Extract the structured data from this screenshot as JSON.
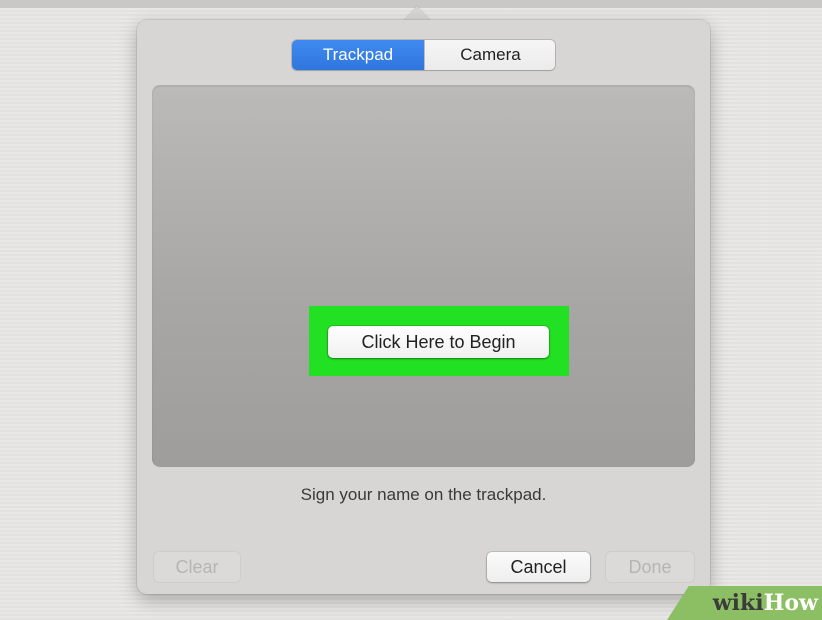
{
  "tabs": [
    {
      "label": "Trackpad",
      "selected": true
    },
    {
      "label": "Camera",
      "selected": false
    }
  ],
  "pad": {
    "begin_label": "Click Here to Begin"
  },
  "instruction": "Sign your name on the trackpad.",
  "buttons": {
    "clear": "Clear",
    "cancel": "Cancel",
    "done": "Done"
  },
  "watermark": {
    "part1": "wiki",
    "part2": "How"
  },
  "colors": {
    "accent_blue": "#2f76de",
    "highlight_green": "#22e022",
    "watermark_green": "#8cbf63"
  }
}
